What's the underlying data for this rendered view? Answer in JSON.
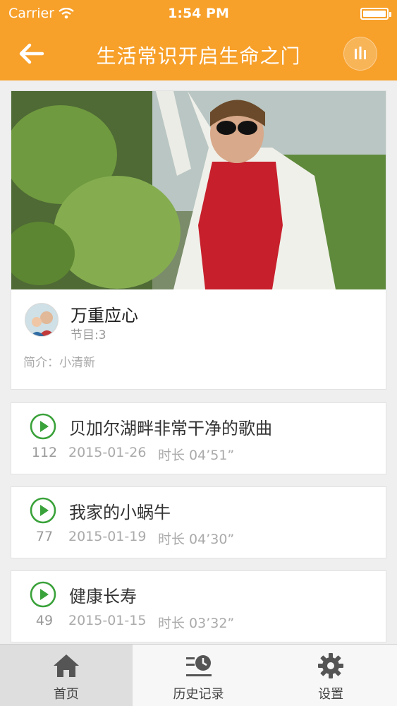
{
  "status": {
    "carrier": "Carrier",
    "time": "1:54 PM"
  },
  "nav": {
    "title": "生活常识开启生命之门"
  },
  "profile": {
    "name": "万重应心",
    "count": "节目:3",
    "desc": "简介：小清新"
  },
  "tracks": [
    {
      "title": "贝加尔湖畔非常干净的歌曲",
      "count": "112",
      "date": "2015-01-26",
      "duration": "时长 04’51”"
    },
    {
      "title": "我家的小蜗牛",
      "count": "77",
      "date": "2015-01-19",
      "duration": "时长 04’30”"
    },
    {
      "title": "健康长寿",
      "count": "49",
      "date": "2015-01-15",
      "duration": "时长 03’32”"
    }
  ],
  "tabs": [
    {
      "label": "首页",
      "icon": "home-icon",
      "active": true
    },
    {
      "label": "历史记录",
      "icon": "history-icon",
      "active": false
    },
    {
      "label": "设置",
      "icon": "gear-icon",
      "active": false
    }
  ],
  "colors": {
    "accent": "#f7a02a",
    "play": "#3aa23a"
  }
}
